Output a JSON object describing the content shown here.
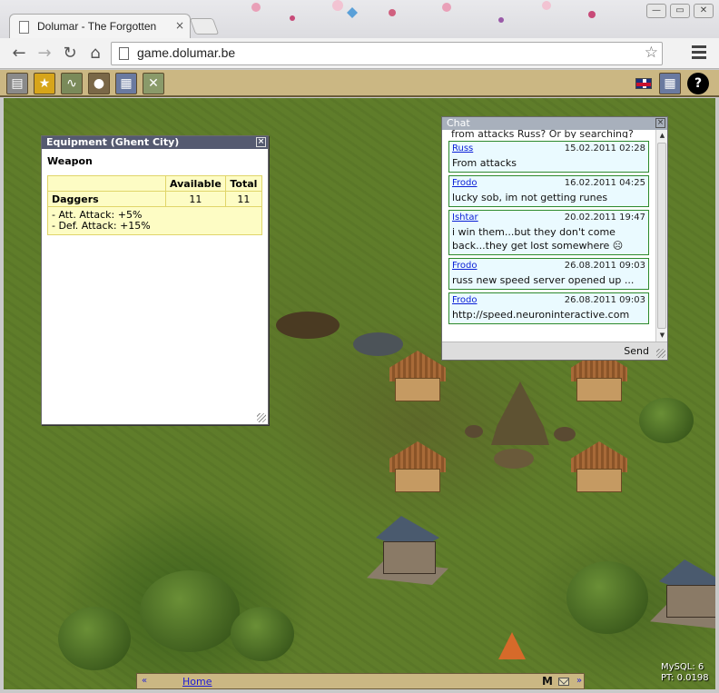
{
  "browser": {
    "tab_title": "Dolumar - The Forgotten",
    "tab_close": "×",
    "url": "game.dolumar.be",
    "back": "←",
    "forward": "→",
    "reload": "↻",
    "home": "⌂",
    "star": "☆",
    "win_min": "—",
    "win_max": "▭",
    "win_close": "✕"
  },
  "gamebar": {
    "icons": [
      {
        "name": "buildings-icon",
        "color": "#8a8a8a"
      },
      {
        "name": "star-icon",
        "color": "#d7a51a"
      },
      {
        "name": "stats-icon",
        "color": "#7a8a5a"
      },
      {
        "name": "resources-icon",
        "color": "#7a6848"
      },
      {
        "name": "map-icon",
        "color": "#6a7aa0"
      },
      {
        "name": "tools-icon",
        "color": "#8a9a6a"
      }
    ],
    "help_label": "?"
  },
  "equipment": {
    "title": "Equipment (Ghent City)",
    "close": "×",
    "category": "Weapon",
    "headers": {
      "available": "Available",
      "total": "Total"
    },
    "item": {
      "name": "Daggers",
      "available": "11",
      "total": "11"
    },
    "bonus_1": "- Att. Attack: +5%",
    "bonus_2": "- Def. Attack: +15%"
  },
  "chat": {
    "title": "Chat",
    "close": "×",
    "clipped_text": "from attacks Russ? Or by searching?",
    "messages": [
      {
        "user": "Russ",
        "date": "15.02.2011 02:28",
        "text": "From attacks"
      },
      {
        "user": "Frodo",
        "date": "16.02.2011 04:25",
        "text": "lucky sob, im not getting runes"
      },
      {
        "user": "Ishtar",
        "date": "20.02.2011 19:47",
        "text": "i win them...but they don't come back...they get lost somewhere ☹"
      },
      {
        "user": "Frodo",
        "date": "26.08.2011 09:03",
        "text": "russ new speed server opened up ..."
      },
      {
        "user": "Frodo",
        "date": "26.08.2011 09:03",
        "text": "http://speed.neuroninteractive.com"
      }
    ],
    "send_label": "Send",
    "scroll_up": "▲",
    "scroll_down": "▼"
  },
  "footer": {
    "prev": "«",
    "home_link": "Home",
    "mail_letter": "M",
    "next": "»"
  },
  "server_stats": {
    "mysql": "MySQL: 6",
    "pt": "PT: 0.0198"
  }
}
